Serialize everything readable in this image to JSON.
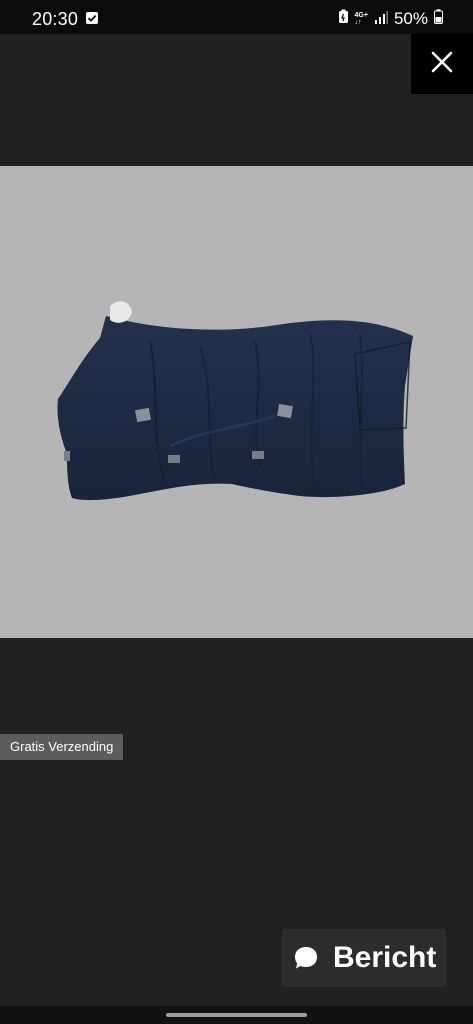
{
  "status_bar": {
    "time": "20:30",
    "network": "4G+",
    "battery": "50%"
  },
  "close_icon": "close-icon",
  "product_image": {
    "icon": "horse-blanket-image",
    "background": "#b5b5b5",
    "blanket_color": "#1c2a42"
  },
  "badge": {
    "label": "Gratis Verzending"
  },
  "message_button": {
    "label": "Bericht",
    "icon": "chat-bubble-icon"
  }
}
